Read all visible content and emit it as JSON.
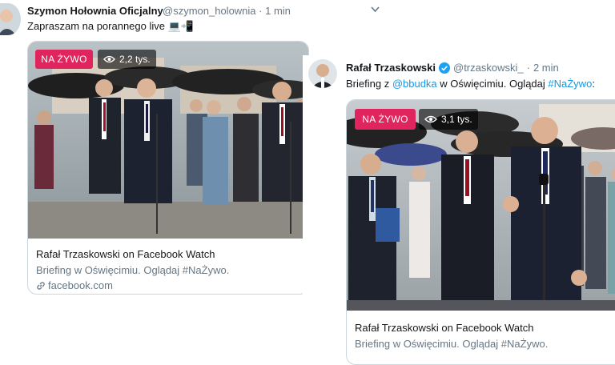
{
  "tweet1": {
    "author_name": "Szymon Hołownia Oficjalny",
    "handle": "@szymon_holownia",
    "separator": "·",
    "time": "1 min",
    "text": "Zapraszam na porannego live",
    "emoji": "💻📲",
    "card": {
      "live_label": "NA ŻYWO",
      "views": "2,2 tys.",
      "title": "Rafał Trzaskowski on Facebook Watch",
      "description": "Briefing w Oświęcimiu. Oglądaj #NaŻywo.",
      "domain": "facebook.com"
    }
  },
  "tweet2": {
    "author_name": "Rafał Trzaskowski",
    "verified": true,
    "handle": "@trzaskowski_",
    "separator": "·",
    "time": "2 min",
    "text_prefix": "Briefing z ",
    "mention": "@bbudka",
    "text_middle": " w Oświęcimiu. Oglądaj ",
    "hashtag": "#NaŻywo",
    "text_suffix": ":",
    "card": {
      "live_label": "NA ŻYWO",
      "views": "3,1 tys.",
      "title": "Rafał Trzaskowski on Facebook Watch",
      "description": "Briefing w Oświęcimiu. Oglądaj #NaŻywo."
    }
  },
  "colors": {
    "live_red": "#e0245e",
    "link_blue": "#1b95e0",
    "secondary_text": "#657786",
    "verified_blue": "#1da1f2"
  },
  "icons": [
    "chevron-down-icon",
    "eye-icon",
    "link-icon",
    "verified-badge-icon"
  ]
}
